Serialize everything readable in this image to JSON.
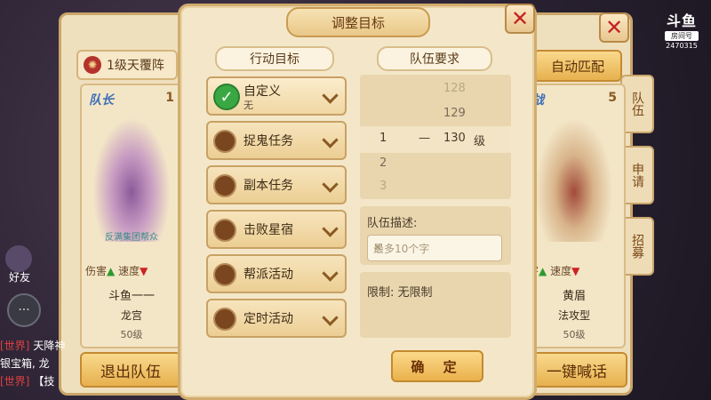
{
  "background_panel": {
    "formation_label": "1级天覆阵",
    "auto_match_label": "自动匹配",
    "side_tabs": [
      "队伍",
      "申请",
      "招募"
    ],
    "left_card": {
      "role": "队长",
      "slot": "1",
      "tag": "反满集团帮众",
      "stat_damage": "伤害",
      "stat_speed": "速度",
      "name": "斗鱼一一",
      "school": "龙宫",
      "level": "50级"
    },
    "right_card": {
      "role": "战",
      "slot": "5",
      "stat_damage": "害",
      "stat_speed": "速度",
      "name": "黄眉",
      "school": "法攻型",
      "level": "50级"
    },
    "leave_team_label": "退出队伍",
    "shout_label": "一键喊话"
  },
  "left_hud": {
    "friends_label": "好友",
    "chat_lines": [
      {
        "channel": "[世界]",
        "text": "天降神"
      },
      {
        "channel": "",
        "text": "银宝箱, 龙"
      },
      {
        "channel": "[世界]",
        "text": "【技"
      }
    ]
  },
  "watermark": {
    "logo": "斗鱼",
    "room_label": "房间号",
    "room_number": "2470315"
  },
  "modal": {
    "title": "调整目标",
    "goal_section_title": "行动目标",
    "team_req_title": "队伍要求",
    "goals": [
      {
        "label": "自定义",
        "sub": "无",
        "selected": true
      },
      {
        "label": "捉鬼任务",
        "sub": "",
        "selected": false
      },
      {
        "label": "副本任务",
        "sub": "",
        "selected": false
      },
      {
        "label": "击败星宿",
        "sub": "",
        "selected": false
      },
      {
        "label": "帮派活动",
        "sub": "",
        "selected": false
      },
      {
        "label": "定时活动",
        "sub": "",
        "selected": false
      }
    ],
    "level_picker": {
      "above": [
        "128",
        "129"
      ],
      "min": "1",
      "dash": "—",
      "max": "130",
      "unit": "级",
      "below": [
        "2",
        "3"
      ]
    },
    "desc_label": "队伍描述:",
    "desc_placeholder": "最多10个字",
    "limit_text": "限制: 无限制",
    "confirm_label": "确 定"
  }
}
